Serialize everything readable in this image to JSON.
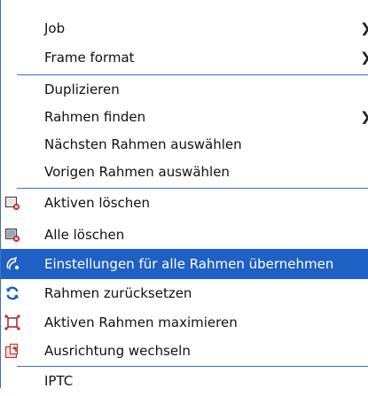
{
  "menu": {
    "items": {
      "job": {
        "label": "Job"
      },
      "frame_format": {
        "label": "Frame format"
      },
      "duplizieren": {
        "label": "Duplizieren"
      },
      "rahmen_finden": {
        "label": "Rahmen finden"
      },
      "naechsten": {
        "label": "Nächsten Rahmen auswählen"
      },
      "vorigen": {
        "label": "Vorigen Rahmen auswählen"
      },
      "aktiven_loeschen": {
        "label": "Aktiven löschen",
        "icon": "frame-delete-icon"
      },
      "alle_loeschen": {
        "label": "Alle löschen",
        "icon": "frames-delete-all-icon"
      },
      "einstellungen": {
        "label": "Einstellungen für alle Rahmen übernehmen",
        "icon": "apply-settings-icon",
        "selected": true
      },
      "zuruecksetzen": {
        "label": "Rahmen zurücksetzen",
        "icon": "reset-arrows-icon"
      },
      "maximieren": {
        "label": "Aktiven Rahmen maximieren",
        "icon": "maximize-frame-icon"
      },
      "ausrichtung": {
        "label": "Ausrichtung wechseln",
        "icon": "rotate-orientation-icon"
      },
      "iptc": {
        "label": "IPTC"
      }
    },
    "submenu_arrow": "❯",
    "colors": {
      "selection": "#1f60c4",
      "separator": "#3a73c8",
      "icon_red": "#d2221c",
      "icon_blue": "#1d5fb8"
    }
  }
}
